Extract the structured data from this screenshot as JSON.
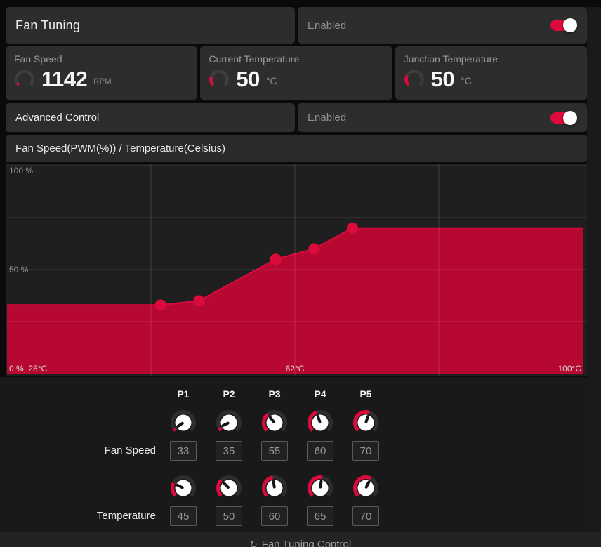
{
  "header": {
    "title": "Fan Tuning",
    "status_label": "Enabled",
    "toggle_on": true
  },
  "stats": [
    {
      "label": "Fan Speed",
      "value": "1142",
      "unit": "RPM",
      "gauge_sweep": 14
    },
    {
      "label": "Current Temperature",
      "value": "50",
      "unit": "°C",
      "gauge_sweep": 62
    },
    {
      "label": "Junction Temperature",
      "value": "50",
      "unit": "°C",
      "gauge_sweep": 72
    }
  ],
  "advanced": {
    "label": "Advanced Control",
    "status_label": "Enabled",
    "toggle_on": true
  },
  "chart_header": {
    "title": "Fan Speed(PWM(%)) / Temperature(Celsius)"
  },
  "chart_data": {
    "type": "area",
    "title": "Fan Speed(PWM(%)) / Temperature(Celsius)",
    "xlabel": "Temperature (Celsius)",
    "ylabel": "Fan Speed (PWM %)",
    "xlim": [
      25,
      100
    ],
    "ylim": [
      0,
      100
    ],
    "x": [
      25,
      45,
      50,
      60,
      65,
      70,
      100
    ],
    "y": [
      33,
      33,
      35,
      55,
      60,
      70,
      70
    ],
    "points": [
      {
        "label": "P1",
        "temp": 45,
        "speed": 33
      },
      {
        "label": "P2",
        "temp": 50,
        "speed": 35
      },
      {
        "label": "P3",
        "temp": 60,
        "speed": 55
      },
      {
        "label": "P4",
        "temp": 65,
        "speed": 60
      },
      {
        "label": "P5",
        "temp": 70,
        "speed": 70
      }
    ],
    "y_tick_labels": [
      "100 %",
      "50 %"
    ],
    "x_tick_labels": [
      "0 %, 25°C",
      "62°C",
      "100°C"
    ],
    "grid": true,
    "legend": false
  },
  "curve_editor": {
    "point_labels": [
      "P1",
      "P2",
      "P3",
      "P4",
      "P5"
    ],
    "rows": [
      {
        "label": "Fan Speed",
        "values": [
          33,
          35,
          55,
          60,
          70
        ]
      },
      {
        "label": "Temperature",
        "values": [
          45,
          50,
          60,
          65,
          70
        ]
      }
    ]
  },
  "footer": {
    "icon": "↻",
    "label": "Fan Tuning Control"
  },
  "colors": {
    "accent": "#dd0a3c",
    "area_fill": "#b60831",
    "line": "#dc0a3e",
    "point": "#dd0a3c",
    "gauge_track": "#3d3d3d",
    "knob_track": "#2e2e2e",
    "grid_line": "rgba(255,255,255,0.14)"
  }
}
